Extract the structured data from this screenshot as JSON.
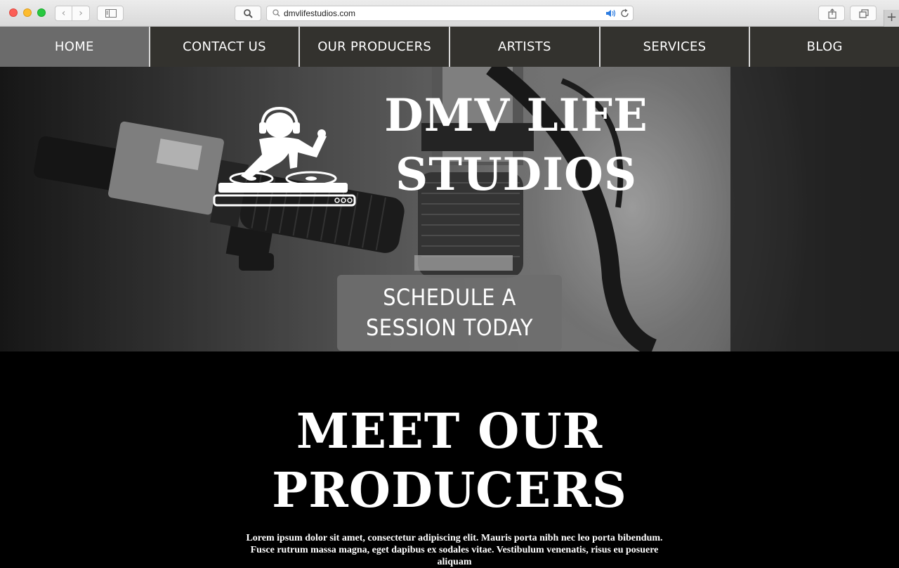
{
  "browser": {
    "url": "dmvlifestudios.com"
  },
  "nav": {
    "items": [
      {
        "label": "HOME",
        "active": true
      },
      {
        "label": "CONTACT US"
      },
      {
        "label": "OUR PRODUCERS"
      },
      {
        "label": "ARTISTS"
      },
      {
        "label": "SERVICES"
      },
      {
        "label": "BLOG"
      }
    ]
  },
  "hero": {
    "title_line1": "DMV LIFE",
    "title_line2": "STUDIOS",
    "cta_line1": "SCHEDULE A",
    "cta_line2": "SESSION TODAY"
  },
  "producers": {
    "title_line1": "MEET OUR",
    "title_line2": "PRODUCERS",
    "body": "Lorem ipsum dolor sit amet, consectetur adipiscing elit. Mauris porta nibh nec leo porta bibendum. Fusce rutrum massa magna, eget dapibus ex sodales vitae. Vestibulum venenatis, risus eu posuere aliquam"
  },
  "colors": {
    "nav_bg": "#33322e",
    "nav_active_bg": "#6b6b6b",
    "cta_bg": "#6e6e6e"
  }
}
